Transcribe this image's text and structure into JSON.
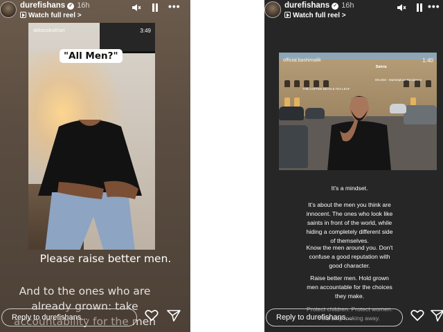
{
  "left_story": {
    "username": "durefishans",
    "time_ago": "16h",
    "watch_label": "Watch full reel",
    "watch_chevron": ">",
    "video": {
      "handle": "abbassbukhari",
      "duration": "3:49",
      "caption": "\"All Men?\""
    },
    "line1": "Please raise better men.",
    "line2": "And to the ones who are already grown: take accountability for the men you've chosen to become.",
    "reply_placeholder": "Reply to durefishans..."
  },
  "right_story": {
    "username": "durefishans",
    "time_ago": "16h",
    "watch_label": "Watch full reel",
    "watch_chevron": ">",
    "video": {
      "handle": "official.bashimalik",
      "duration": "1:40",
      "sign1": "Bahria",
      "sign2": "DN.D02 - Marketplace Residence",
      "sign3": "THE COFFEE BEAN & TEA LEAF"
    },
    "paragraphs": [
      "It's a mindset.",
      "It's about the men you think are innocent. The ones who look like saints in front of the world, while hiding a completely different side of themselves.",
      "Know the men around you. Don't confuse a good reputation with good character.",
      "Raise better men. Hold grown men accountable for the choices they make.",
      "Protect children. Protect women. And stop looking away."
    ],
    "reply_placeholder": "Reply to durefishans..."
  },
  "icons": {
    "verified": "verified-badge-icon",
    "mute": "speaker-muted-icon",
    "pause": "pause-icon",
    "more": "more-options-icon",
    "heart": "heart-icon",
    "send": "send-icon",
    "play": "reel-play-icon"
  },
  "colors": {
    "left_bg": "#5a4c40",
    "right_bg": "#262626",
    "text": "#ffffff"
  }
}
